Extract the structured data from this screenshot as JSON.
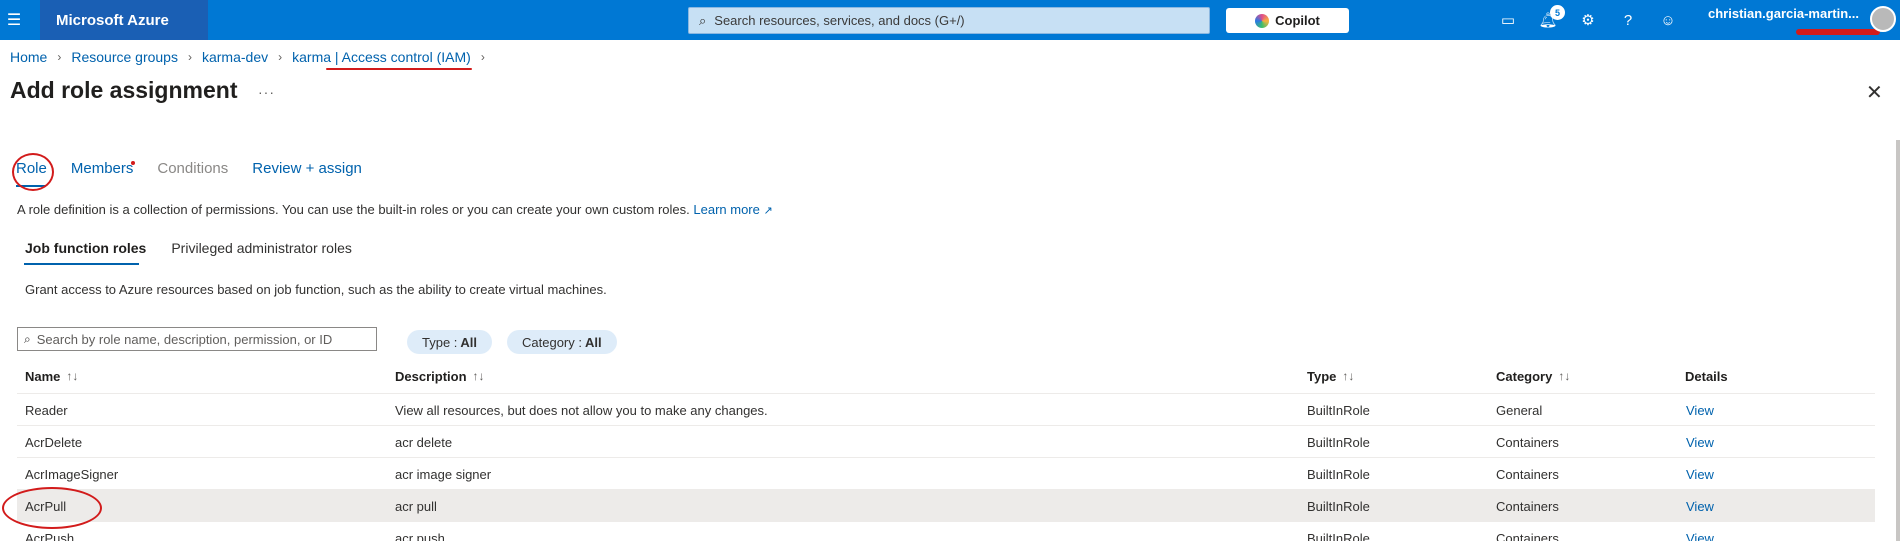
{
  "topbar": {
    "brand": "Microsoft Azure",
    "search_placeholder": "Search resources, services, and docs (G+/)",
    "copilot_label": "Copilot",
    "notification_count": "5",
    "user_name": "christian.garcia-martin..."
  },
  "breadcrumb": {
    "items": [
      "Home",
      "Resource groups",
      "karma-dev",
      "karma | Access control (IAM)"
    ]
  },
  "page": {
    "title": "Add role assignment",
    "more_label": "···",
    "close_label": "✕"
  },
  "tabs": [
    {
      "label": "Role",
      "state": "active"
    },
    {
      "label": "Members",
      "state": "enabled"
    },
    {
      "label": "Conditions",
      "state": "disabled"
    },
    {
      "label": "Review + assign",
      "state": "enabled"
    }
  ],
  "description": {
    "text": "A role definition is a collection of permissions. You can use the built-in roles or you can create your own custom roles.",
    "learn_more": "Learn more"
  },
  "subtabs": [
    {
      "label": "Job function roles",
      "active": true
    },
    {
      "label": "Privileged administrator roles",
      "active": false
    }
  ],
  "grant_text": "Grant access to Azure resources based on job function, such as the ability to create virtual machines.",
  "filters": {
    "search_placeholder": "Search by role name, description, permission, or ID",
    "type_label": "Type :",
    "type_value": "All",
    "category_label": "Category :",
    "category_value": "All"
  },
  "table": {
    "headers": {
      "name": "Name",
      "name_sort": "↑↓",
      "description": "Description",
      "description_sort": "↑↓",
      "type": "Type",
      "type_sort": "↑↓",
      "category": "Category",
      "category_sort": "↑↓",
      "details": "Details"
    },
    "rows": [
      {
        "name": "Reader",
        "description": "View all resources, but does not allow you to make any changes.",
        "type": "BuiltInRole",
        "category": "General",
        "details": "View"
      },
      {
        "name": "AcrDelete",
        "description": "acr delete",
        "type": "BuiltInRole",
        "category": "Containers",
        "details": "View"
      },
      {
        "name": "AcrImageSigner",
        "description": "acr image signer",
        "type": "BuiltInRole",
        "category": "Containers",
        "details": "View"
      },
      {
        "name": "AcrPull",
        "description": "acr pull",
        "type": "BuiltInRole",
        "category": "Containers",
        "details": "View"
      },
      {
        "name": "AcrPush",
        "description": "acr push",
        "type": "BuiltInRole",
        "category": "Containers",
        "details": "View"
      }
    ]
  }
}
